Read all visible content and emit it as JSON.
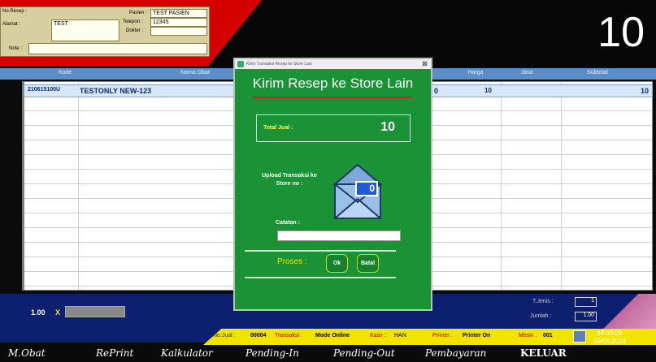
{
  "patient": {
    "no_resep_label": "No.Resep :",
    "alamat_label": "Alamat :",
    "alamat_value": "TEST",
    "pasien_label": "Pasien :",
    "pasien_value": "TEST PASIEN",
    "telepon_label": "Telepon :",
    "telepon_value": "12345",
    "dokter_label": "Dokter :",
    "note_label": "Note :"
  },
  "big_number": "10",
  "columns": {
    "kode": "Kode",
    "nama_obat": "Nama Obat",
    "harga": "Harga",
    "jasa": "Jasa",
    "subtotal": "Subtotal"
  },
  "row": {
    "kode": "210615100U",
    "nama": "TESTONLY NEW-123",
    "qty_partial": "0",
    "harga": "10",
    "subtotal": "10"
  },
  "bottom": {
    "qty": "1.00",
    "x": "X",
    "tjenis_label": "T.Jenis :",
    "tjenis_value": "1",
    "jumlah_label": "Jumlah :",
    "jumlah_value": "1.00"
  },
  "status": {
    "nojual_label": "No.Jual :",
    "nojual_value": "00004",
    "transaksi_label": "Transaksi :",
    "transaksi_value": "Mode Online",
    "kasir_label": "Kasir :",
    "kasir_value": "HAN",
    "printer_label": "Printer :",
    "printer_value": "Printer On",
    "mesin_label": "Mesin :",
    "mesin_value": "001",
    "time": "08:00:29",
    "date": "09/01/2024"
  },
  "menu": [
    "M.Obat",
    "RePrint",
    "Kalkulator",
    "Pending-In",
    "Pending-Out",
    "Pembayaran",
    "KELUAR"
  ],
  "dialog": {
    "window_title": "Kirim Transaksi Resep ke Store Lain",
    "close": "⊠",
    "title": "Kirim Resep ke Store Lain",
    "total_label": "Total Jual :",
    "total_value": "10",
    "upload_label": "Upload Transaksi ke Store no :",
    "upload_value": "0",
    "catatan_label": "Catatan :",
    "catatan_value": "",
    "proses_label": "Proses :",
    "ok_label": "Ok",
    "batal_label": "Batal"
  },
  "colors": {
    "header_red": "#d50000",
    "dialog_green": "#1a9336",
    "status_yellow": "#f2e400",
    "bottom_navy": "#0d1f6f"
  },
  "icons": [
    "envelope-icon",
    "pencil-icon",
    "printer-icon"
  ]
}
